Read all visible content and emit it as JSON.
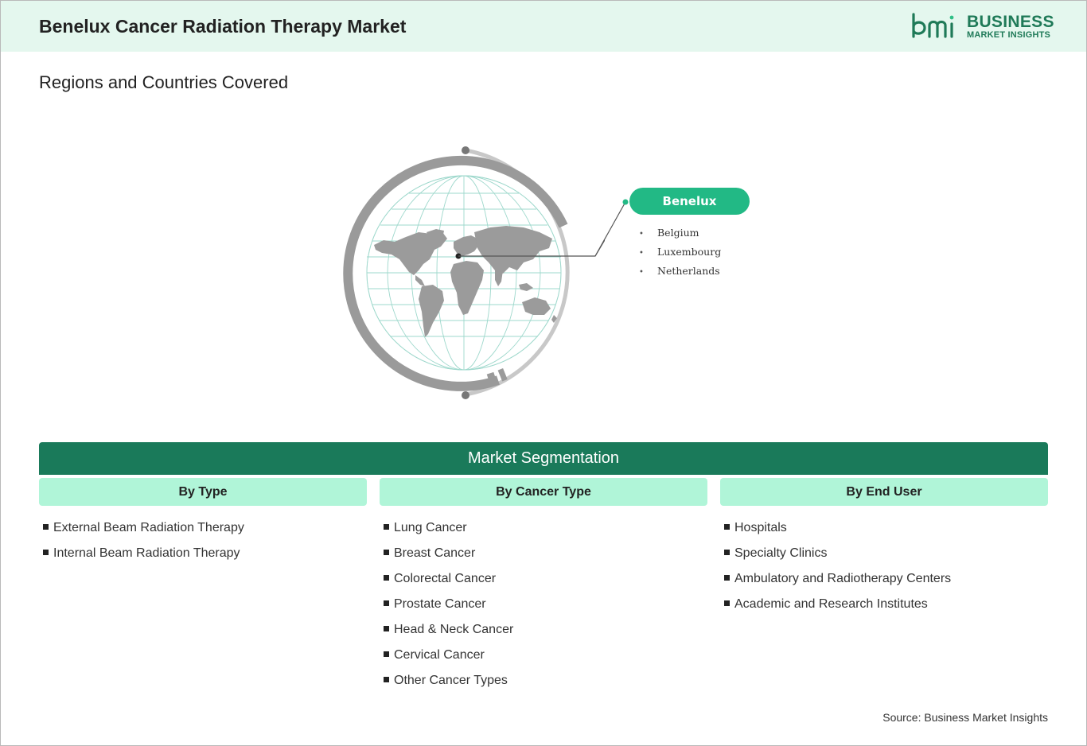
{
  "header": {
    "title": "Benelux Cancer Radiation Therapy Market",
    "logo_line1": "BUSINESS",
    "logo_line2": "MARKET INSIGHTS",
    "brand_color": "#1f7a58"
  },
  "regions": {
    "heading": "Regions and Countries Covered",
    "region_label": "Benelux",
    "countries": [
      "Belgium",
      "Luxembourg",
      "Netherlands"
    ],
    "accent_color": "#22b985"
  },
  "segmentation": {
    "title": "Market Segmentation",
    "columns": [
      {
        "heading": "By Type",
        "items": [
          "External Beam Radiation Therapy",
          "Internal Beam Radiation Therapy"
        ]
      },
      {
        "heading": "By Cancer Type",
        "items": [
          "Lung Cancer",
          "Breast Cancer",
          "Colorectal Cancer",
          "Prostate Cancer",
          "Head & Neck Cancer",
          "Cervical Cancer",
          "Other Cancer Types"
        ]
      },
      {
        "heading": "By End User",
        "items": [
          "Hospitals",
          "Specialty Clinics",
          "Ambulatory and Radiotherapy Centers",
          "Academic and Research Institutes"
        ]
      }
    ],
    "bar_color": "#1a7a5a",
    "column_header_color": "#b0f5d8"
  },
  "footer": {
    "source": "Source: Business Market Insights"
  }
}
